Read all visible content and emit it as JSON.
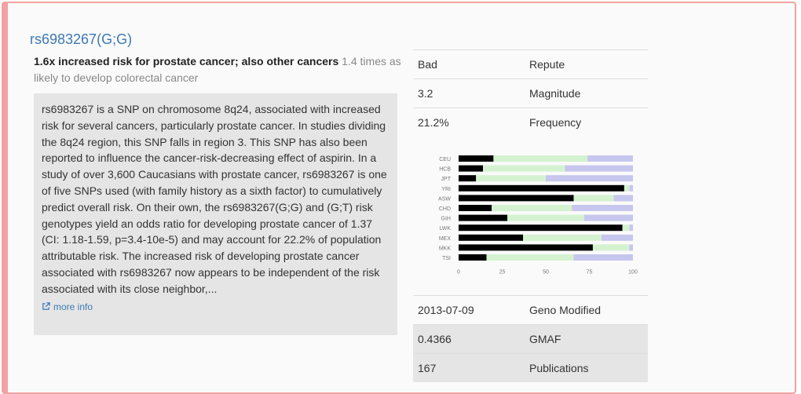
{
  "snp": {
    "title": "rs6983267(G;G)",
    "summary_bold": "1.6x increased risk for prostate cancer; also other cancers",
    "summary_rest": " 1.4 times as likely to develop colorectal cancer",
    "description": "rs6983267 is a SNP on chromosome 8q24, associated with increased risk for several cancers, particularly prostate cancer. In studies dividing the 8q24 region, this SNP falls in region 3. This SNP has also been reported to influence the cancer-risk-decreasing effect of aspirin. In a study of over 3,600 Caucasians with prostate cancer, rs6983267 is one of five SNPs used (with family history as a sixth factor) to cumulatively predict overall risk. On their own, the rs6983267(G;G) and (G;T) risk genotypes yield an odds ratio for developing prostate cancer of 1.37 (CI: 1.18-1.59, p=3.4-10e-5) and may account for 22.2% of population attributable risk. The increased risk of developing prostate cancer associated with rs6983267 now appears to be independent of the risk associated with its close neighbor,...",
    "more_info": "more info"
  },
  "info_top": [
    {
      "value": "Bad",
      "label": "Repute"
    },
    {
      "value": "3.2",
      "label": "Magnitude"
    },
    {
      "value": "21.2%",
      "label": "Frequency"
    }
  ],
  "info_bottom": [
    {
      "value": "2013-07-09",
      "label": "Geno Modified"
    },
    {
      "value": "0.4366",
      "label": "GMAF"
    },
    {
      "value": "167",
      "label": "Publications"
    }
  ],
  "colors": {
    "black": "#000000",
    "green": "#d4f2d0",
    "purple": "#c6c6ee",
    "link": "#3c78b4",
    "border": "#f2a2a2"
  },
  "chart_data": {
    "type": "bar",
    "stacked": true,
    "orientation": "horizontal",
    "categories": [
      "CEU",
      "HCB",
      "JPT",
      "YRI",
      "ASW",
      "CHD",
      "GIH",
      "LWK",
      "MEX",
      "MKK",
      "TSI"
    ],
    "series": [
      {
        "color": "#000000",
        "values": [
          20,
          14,
          10,
          95,
          66,
          19,
          28,
          94,
          37,
          77,
          16
        ]
      },
      {
        "color": "#d4f2d0",
        "values": [
          54,
          47,
          40,
          3,
          23,
          46,
          44,
          4,
          45,
          21,
          50
        ]
      },
      {
        "color": "#c6c6ee",
        "values": [
          26,
          39,
          50,
          2,
          11,
          35,
          28,
          2,
          18,
          2,
          34
        ]
      }
    ],
    "xlim": [
      0,
      100
    ],
    "xticks": [
      "0",
      "25",
      "50",
      "75",
      "100"
    ]
  }
}
